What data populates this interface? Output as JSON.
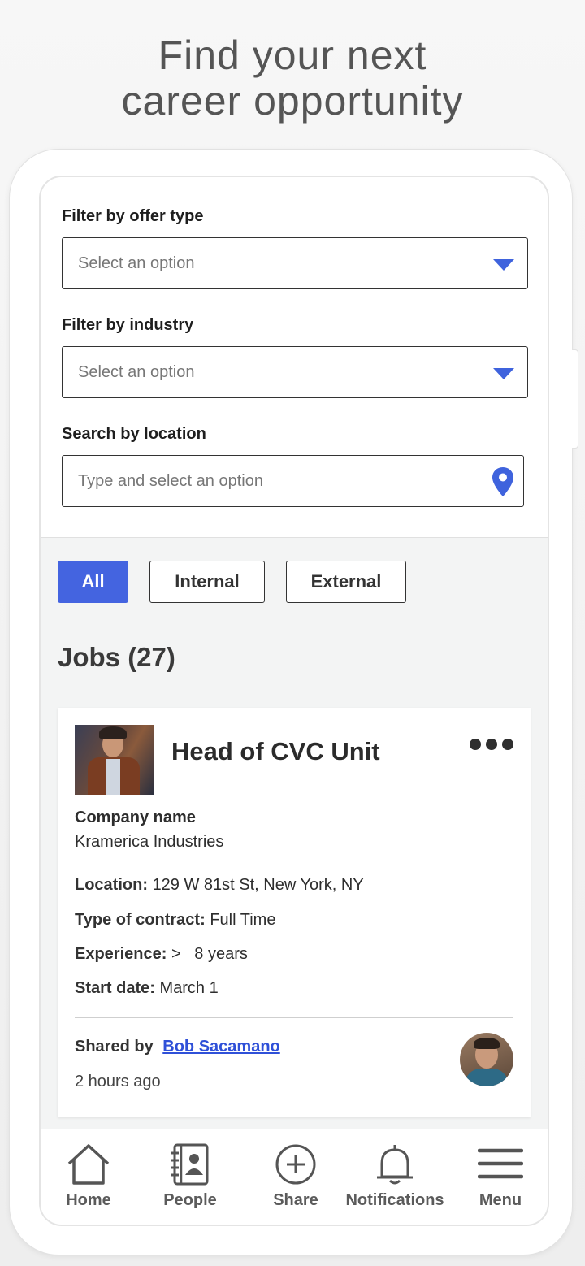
{
  "hero": {
    "line1": "Find your next",
    "line2": "career opportunity"
  },
  "filters": {
    "offer_type": {
      "label": "Filter by offer type",
      "placeholder": "Select an option"
    },
    "industry": {
      "label": "Filter by industry",
      "placeholder": "Select an option"
    },
    "location": {
      "label": "Search by location",
      "placeholder": "Type and select an option"
    }
  },
  "tabs": [
    {
      "label": "All",
      "active": true
    },
    {
      "label": "Internal",
      "active": false
    },
    {
      "label": "External",
      "active": false
    }
  ],
  "jobs": {
    "title": "Jobs (27)",
    "card": {
      "title": "Head of CVC Unit",
      "company_label": "Company name",
      "company": "Kramerica Industries",
      "location_label": "Location:",
      "location": "129 W 81st St, New York, NY",
      "contract_label": "Type of contract:",
      "contract": "Full Time",
      "experience_label": "Experience:",
      "experience": ">   8 years",
      "start_label": "Start date:",
      "start": "March 1",
      "shared_label": "Shared by",
      "shared_by": "Bob Sacamano",
      "time": "2 hours ago"
    }
  },
  "nav": [
    {
      "label": "Home",
      "icon": "home-icon"
    },
    {
      "label": "People",
      "icon": "contacts-book-icon"
    },
    {
      "label": "Share",
      "icon": "plus-circle-icon"
    },
    {
      "label": "Notifications",
      "icon": "bell-icon"
    },
    {
      "label": "Menu",
      "icon": "hamburger-menu-icon"
    }
  ],
  "colors": {
    "accent": "#4464e0",
    "link": "#2f50d8"
  }
}
